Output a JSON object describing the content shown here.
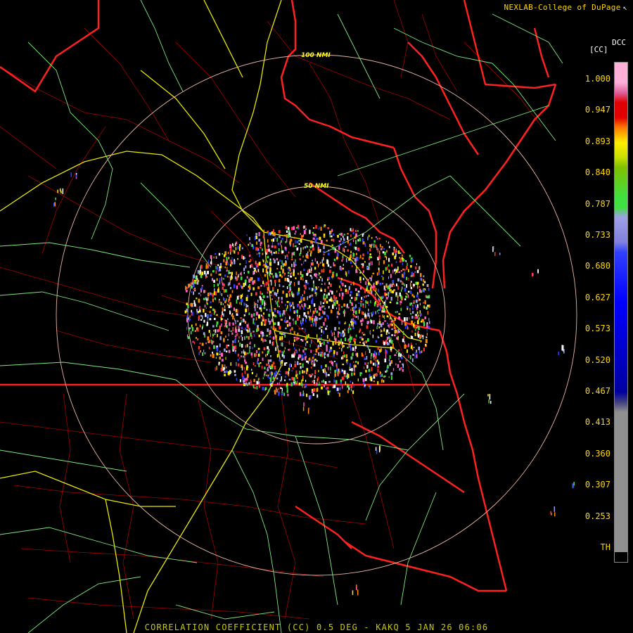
{
  "header": {
    "source": "NEXLAB-College of DuPage",
    "icon": "cursor-arrow-icon"
  },
  "map": {
    "product_code": "DCC",
    "unit": "[CC]",
    "range_rings": [
      {
        "label": "50 NMI"
      },
      {
        "label": "100 NMI"
      }
    ]
  },
  "legend": {
    "ticks": [
      "1.000",
      "0.947",
      "0.893",
      "0.840",
      "0.787",
      "0.733",
      "0.680",
      "0.627",
      "0.573",
      "0.520",
      "0.467",
      "0.413",
      "0.360",
      "0.307",
      "0.253",
      "TH"
    ],
    "colors": {
      "top": "#ffb0d8",
      "red": "#e00000",
      "orange": "#ff7a00",
      "yellow": "#ffee00",
      "green": "#40e040",
      "lavender": "#a0a0e8",
      "blue": "#0000ff",
      "gray": "#909090"
    }
  },
  "footer": {
    "caption": "CORRELATION COEFFICIENT (CC) 0.5 DEG - KAKQ 5 JAN 26 06:06"
  }
}
